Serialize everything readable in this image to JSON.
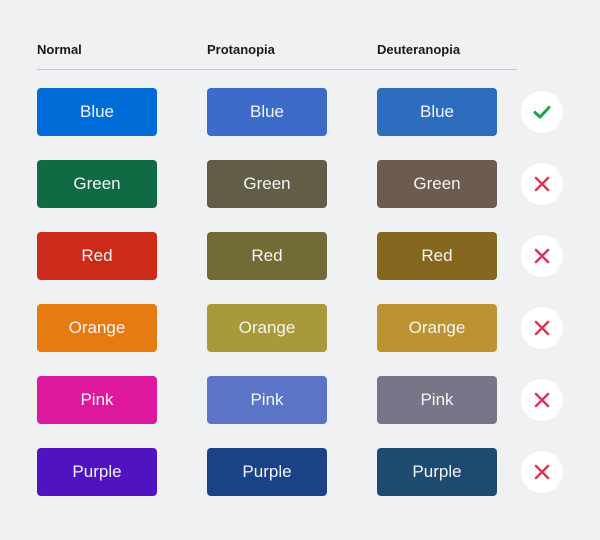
{
  "columns": [
    "Normal",
    "Protanopia",
    "Deuteranopia"
  ],
  "rows": [
    {
      "label": "Blue",
      "colors": [
        "#006bd6",
        "#3d6bc9",
        "#2e6dbe"
      ],
      "distinguishable": true,
      "status_icon": "check-icon"
    },
    {
      "label": "Green",
      "colors": [
        "#106a44",
        "#625d45",
        "#6c5b4e"
      ],
      "distinguishable": false,
      "status_icon": "cross-icon"
    },
    {
      "label": "Red",
      "colors": [
        "#cd2a19",
        "#736b35",
        "#856720"
      ],
      "distinguishable": false,
      "status_icon": "cross-icon"
    },
    {
      "label": "Orange",
      "colors": [
        "#e67c11",
        "#a89a3b",
        "#bb9332"
      ],
      "distinguishable": false,
      "status_icon": "cross-icon"
    },
    {
      "label": "Pink",
      "colors": [
        "#de189c",
        "#5a74c8",
        "#797487"
      ],
      "distinguishable": false,
      "status_icon": "cross-icon"
    },
    {
      "label": "Purple",
      "colors": [
        "#5013c1",
        "#1b4287",
        "#1e4a72"
      ],
      "distinguishable": false,
      "status_icon": "cross-icon"
    }
  ],
  "status_colors": {
    "pass": "#1aa352",
    "fail": "#d7395b"
  }
}
